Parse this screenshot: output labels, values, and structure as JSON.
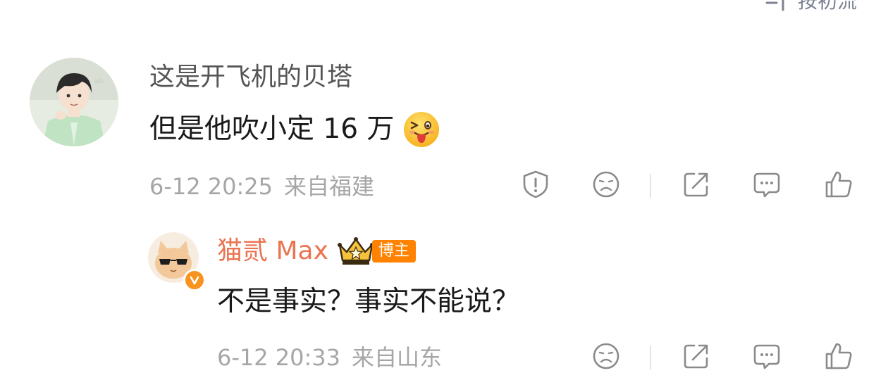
{
  "sort": {
    "label": "按初流",
    "icon": "sort-icon"
  },
  "comment": {
    "username": "这是开飞机的贝塔",
    "text": "但是他吹小定 16 万",
    "emoji": "squinting-tongue-emoji",
    "time": "6-12 20:25",
    "location": "来自福建",
    "actions": [
      "report-icon",
      "dislike-face-icon",
      "share-icon",
      "reply-icon",
      "like-icon"
    ]
  },
  "reply": {
    "username": "猫贰 Max",
    "badge": "博主",
    "crown": "crown-icon",
    "verified": "verified-badge-icon",
    "text": "不是事实？事实不能说？",
    "time": "6-12 20:33",
    "location": "来自山东",
    "actions": [
      "dislike-face-icon",
      "share-icon",
      "reply-icon",
      "like-icon"
    ]
  },
  "colors": {
    "username": "#555555",
    "reply_username": "#eb7350",
    "badge_bg": "#ff8200",
    "meta": "#a6a6a6",
    "icon": "#8a8a8a"
  }
}
